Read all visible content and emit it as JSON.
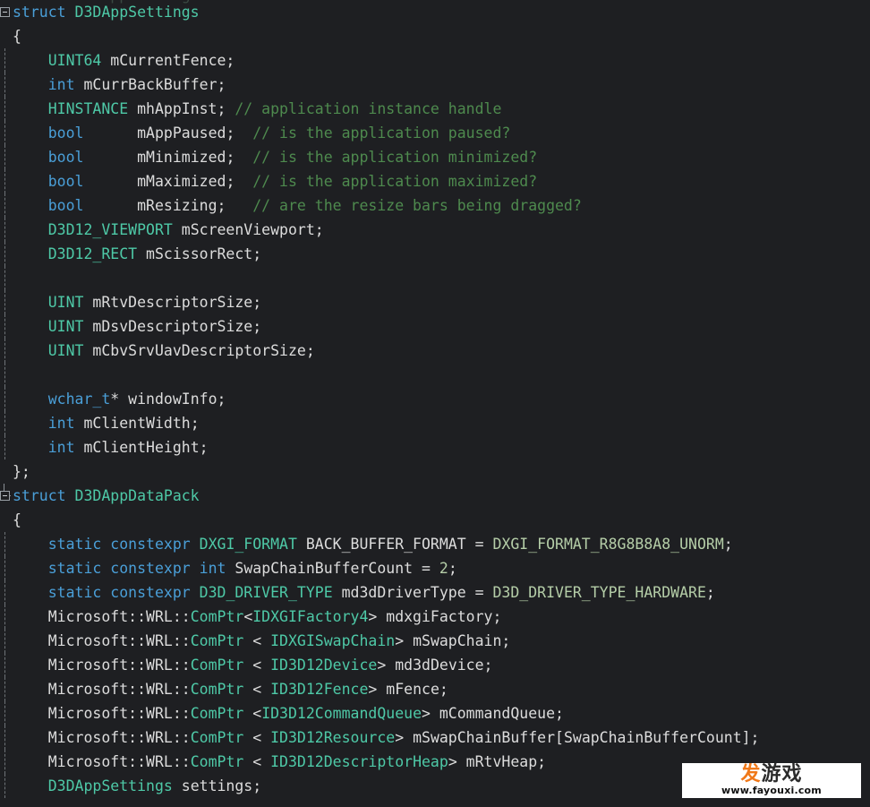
{
  "editor": {
    "language": "cpp",
    "background_color": "#1e1f22",
    "theme": "dark",
    "clipped_top_line": "struct D3DAppSettings"
  },
  "colors": {
    "keyword": "#4a9fd8",
    "type": "#4ec9a7",
    "enum_constant": "#b5cea8",
    "comment": "#4e8a4e",
    "plain": "#dcdcdc",
    "background": "#1e1f22",
    "fold_box_border": "#9aa0a6",
    "indent_guide": "#6e7377"
  },
  "gutter": {
    "fold_marker_lines": [
      1,
      22
    ],
    "fold_marker_glyph": "minus-box"
  },
  "lines": [
    {
      "n": 1,
      "fold": "open",
      "tokens": [
        {
          "t": "struct",
          "c": "kw"
        },
        {
          "t": " ",
          "c": "pln"
        },
        {
          "t": "D3DAppSettings",
          "c": "typ"
        }
      ]
    },
    {
      "n": 2,
      "tokens": [
        {
          "t": "{",
          "c": "pln"
        }
      ]
    },
    {
      "n": 3,
      "guide": true,
      "tokens": [
        {
          "t": "    ",
          "c": "pln"
        },
        {
          "t": "UINT64",
          "c": "typ"
        },
        {
          "t": " mCurrentFence;",
          "c": "pln"
        }
      ]
    },
    {
      "n": 4,
      "guide": true,
      "tokens": [
        {
          "t": "    ",
          "c": "pln"
        },
        {
          "t": "int",
          "c": "kw"
        },
        {
          "t": " mCurrBackBuffer;",
          "c": "pln"
        }
      ]
    },
    {
      "n": 5,
      "guide": true,
      "tokens": [
        {
          "t": "    ",
          "c": "pln"
        },
        {
          "t": "HINSTANCE",
          "c": "typ"
        },
        {
          "t": " mhAppInst; ",
          "c": "pln"
        },
        {
          "t": "// application instance handle",
          "c": "cmt"
        }
      ]
    },
    {
      "n": 6,
      "guide": true,
      "tokens": [
        {
          "t": "    ",
          "c": "pln"
        },
        {
          "t": "bool",
          "c": "kw"
        },
        {
          "t": "      mAppPaused;  ",
          "c": "pln"
        },
        {
          "t": "// is the application paused?",
          "c": "cmt"
        }
      ]
    },
    {
      "n": 7,
      "guide": true,
      "tokens": [
        {
          "t": "    ",
          "c": "pln"
        },
        {
          "t": "bool",
          "c": "kw"
        },
        {
          "t": "      mMinimized;  ",
          "c": "pln"
        },
        {
          "t": "// is the application minimized?",
          "c": "cmt"
        }
      ]
    },
    {
      "n": 8,
      "guide": true,
      "tokens": [
        {
          "t": "    ",
          "c": "pln"
        },
        {
          "t": "bool",
          "c": "kw"
        },
        {
          "t": "      mMaximized;  ",
          "c": "pln"
        },
        {
          "t": "// is the application maximized?",
          "c": "cmt"
        }
      ]
    },
    {
      "n": 9,
      "guide": true,
      "tokens": [
        {
          "t": "    ",
          "c": "pln"
        },
        {
          "t": "bool",
          "c": "kw"
        },
        {
          "t": "      mResizing;   ",
          "c": "pln"
        },
        {
          "t": "// are the resize bars being dragged?",
          "c": "cmt"
        }
      ]
    },
    {
      "n": 10,
      "guide": true,
      "tokens": [
        {
          "t": "    ",
          "c": "pln"
        },
        {
          "t": "D3D12_VIEWPORT",
          "c": "typ"
        },
        {
          "t": " mScreenViewport;",
          "c": "pln"
        }
      ]
    },
    {
      "n": 11,
      "guide": true,
      "tokens": [
        {
          "t": "    ",
          "c": "pln"
        },
        {
          "t": "D3D12_RECT",
          "c": "typ"
        },
        {
          "t": " mScissorRect;",
          "c": "pln"
        }
      ]
    },
    {
      "n": 12,
      "guide": true,
      "tokens": [
        {
          "t": "",
          "c": "pln"
        }
      ]
    },
    {
      "n": 13,
      "guide": true,
      "tokens": [
        {
          "t": "    ",
          "c": "pln"
        },
        {
          "t": "UINT",
          "c": "typ"
        },
        {
          "t": " mRtvDescriptorSize;",
          "c": "pln"
        }
      ]
    },
    {
      "n": 14,
      "guide": true,
      "tokens": [
        {
          "t": "    ",
          "c": "pln"
        },
        {
          "t": "UINT",
          "c": "typ"
        },
        {
          "t": " mDsvDescriptorSize;",
          "c": "pln"
        }
      ]
    },
    {
      "n": 15,
      "guide": true,
      "tokens": [
        {
          "t": "    ",
          "c": "pln"
        },
        {
          "t": "UINT",
          "c": "typ"
        },
        {
          "t": " mCbvSrvUavDescriptorSize;",
          "c": "pln"
        }
      ]
    },
    {
      "n": 16,
      "guide": true,
      "tokens": [
        {
          "t": "",
          "c": "pln"
        }
      ]
    },
    {
      "n": 17,
      "guide": true,
      "tokens": [
        {
          "t": "    ",
          "c": "pln"
        },
        {
          "t": "wchar_t",
          "c": "kw"
        },
        {
          "t": "* windowInfo;",
          "c": "pln"
        }
      ]
    },
    {
      "n": 18,
      "guide": true,
      "tokens": [
        {
          "t": "    ",
          "c": "pln"
        },
        {
          "t": "int",
          "c": "kw"
        },
        {
          "t": " mClientWidth;",
          "c": "pln"
        }
      ]
    },
    {
      "n": 19,
      "guide": true,
      "tokens": [
        {
          "t": "    ",
          "c": "pln"
        },
        {
          "t": "int",
          "c": "kw"
        },
        {
          "t": " mClientHeight;",
          "c": "pln"
        }
      ]
    },
    {
      "n": 20,
      "tokens": [
        {
          "t": "};",
          "c": "pln"
        }
      ]
    },
    {
      "n": 21,
      "fold": "open",
      "foldstub": true,
      "tokens": [
        {
          "t": "struct",
          "c": "kw"
        },
        {
          "t": " ",
          "c": "pln"
        },
        {
          "t": "D3DAppDataPack",
          "c": "typ"
        }
      ]
    },
    {
      "n": 22,
      "tokens": [
        {
          "t": "{",
          "c": "pln"
        }
      ]
    },
    {
      "n": 23,
      "guide": true,
      "tokens": [
        {
          "t": "    ",
          "c": "pln"
        },
        {
          "t": "static",
          "c": "kw"
        },
        {
          "t": " ",
          "c": "pln"
        },
        {
          "t": "constexpr",
          "c": "kw"
        },
        {
          "t": " ",
          "c": "pln"
        },
        {
          "t": "DXGI_FORMAT",
          "c": "typ"
        },
        {
          "t": " BACK_BUFFER_FORMAT = ",
          "c": "pln"
        },
        {
          "t": "DXGI_FORMAT_R8G8B8A8_UNORM",
          "c": "enm"
        },
        {
          "t": ";",
          "c": "pln"
        }
      ]
    },
    {
      "n": 24,
      "guide": true,
      "tokens": [
        {
          "t": "    ",
          "c": "pln"
        },
        {
          "t": "static",
          "c": "kw"
        },
        {
          "t": " ",
          "c": "pln"
        },
        {
          "t": "constexpr",
          "c": "kw"
        },
        {
          "t": " ",
          "c": "pln"
        },
        {
          "t": "int",
          "c": "kw"
        },
        {
          "t": " SwapChainBufferCount = ",
          "c": "pln"
        },
        {
          "t": "2",
          "c": "num"
        },
        {
          "t": ";",
          "c": "pln"
        }
      ]
    },
    {
      "n": 25,
      "guide": true,
      "tokens": [
        {
          "t": "    ",
          "c": "pln"
        },
        {
          "t": "static",
          "c": "kw"
        },
        {
          "t": " ",
          "c": "pln"
        },
        {
          "t": "constexpr",
          "c": "kw"
        },
        {
          "t": " ",
          "c": "pln"
        },
        {
          "t": "D3D_DRIVER_TYPE",
          "c": "typ"
        },
        {
          "t": " md3dDriverType = ",
          "c": "pln"
        },
        {
          "t": "D3D_DRIVER_TYPE_HARDWARE",
          "c": "enm"
        },
        {
          "t": ";",
          "c": "pln"
        }
      ]
    },
    {
      "n": 26,
      "guide": true,
      "tokens": [
        {
          "t": "    ",
          "c": "pln"
        },
        {
          "t": "Microsoft::WRL::",
          "c": "pln"
        },
        {
          "t": "ComPtr",
          "c": "typ"
        },
        {
          "t": "<",
          "c": "pln"
        },
        {
          "t": "IDXGIFactory4",
          "c": "typ"
        },
        {
          "t": "> mdxgiFactory;",
          "c": "pln"
        }
      ]
    },
    {
      "n": 27,
      "guide": true,
      "tokens": [
        {
          "t": "    ",
          "c": "pln"
        },
        {
          "t": "Microsoft::WRL::",
          "c": "pln"
        },
        {
          "t": "ComPtr",
          "c": "typ"
        },
        {
          "t": " < ",
          "c": "pln"
        },
        {
          "t": "IDXGISwapChain",
          "c": "typ"
        },
        {
          "t": "> mSwapChain;",
          "c": "pln"
        }
      ]
    },
    {
      "n": 28,
      "guide": true,
      "tokens": [
        {
          "t": "    ",
          "c": "pln"
        },
        {
          "t": "Microsoft::WRL::",
          "c": "pln"
        },
        {
          "t": "ComPtr",
          "c": "typ"
        },
        {
          "t": " < ",
          "c": "pln"
        },
        {
          "t": "ID3D12Device",
          "c": "typ"
        },
        {
          "t": "> md3dDevice;",
          "c": "pln"
        }
      ]
    },
    {
      "n": 29,
      "guide": true,
      "tokens": [
        {
          "t": "    ",
          "c": "pln"
        },
        {
          "t": "Microsoft::WRL::",
          "c": "pln"
        },
        {
          "t": "ComPtr",
          "c": "typ"
        },
        {
          "t": " < ",
          "c": "pln"
        },
        {
          "t": "ID3D12Fence",
          "c": "typ"
        },
        {
          "t": "> mFence;",
          "c": "pln"
        }
      ]
    },
    {
      "n": 30,
      "guide": true,
      "tokens": [
        {
          "t": "    ",
          "c": "pln"
        },
        {
          "t": "Microsoft::WRL::",
          "c": "pln"
        },
        {
          "t": "ComPtr",
          "c": "typ"
        },
        {
          "t": " <",
          "c": "pln"
        },
        {
          "t": "ID3D12CommandQueue",
          "c": "typ"
        },
        {
          "t": "> mCommandQueue;",
          "c": "pln"
        }
      ]
    },
    {
      "n": 31,
      "guide": true,
      "tokens": [
        {
          "t": "    ",
          "c": "pln"
        },
        {
          "t": "Microsoft::WRL::",
          "c": "pln"
        },
        {
          "t": "ComPtr",
          "c": "typ"
        },
        {
          "t": " < ",
          "c": "pln"
        },
        {
          "t": "ID3D12Resource",
          "c": "typ"
        },
        {
          "t": "> mSwapChainBuffer[SwapChainBufferCount];",
          "c": "pln"
        }
      ]
    },
    {
      "n": 32,
      "guide": true,
      "tokens": [
        {
          "t": "    ",
          "c": "pln"
        },
        {
          "t": "Microsoft::WRL::",
          "c": "pln"
        },
        {
          "t": "ComPtr",
          "c": "typ"
        },
        {
          "t": " < ",
          "c": "pln"
        },
        {
          "t": "ID3D12DescriptorHeap",
          "c": "typ"
        },
        {
          "t": "> mRtvHeap;",
          "c": "pln"
        }
      ]
    },
    {
      "n": 33,
      "guide": true,
      "tokens": [
        {
          "t": "    ",
          "c": "pln"
        },
        {
          "t": "D3DAppSettings",
          "c": "typ"
        },
        {
          "t": " settings;",
          "c": "pln"
        }
      ]
    }
  ],
  "watermark": {
    "logo_text_orange": "发",
    "logo_text_dark": "游戏",
    "url": "www.fayouxi.com",
    "background": "#ffffff",
    "orange": "#f07818"
  }
}
